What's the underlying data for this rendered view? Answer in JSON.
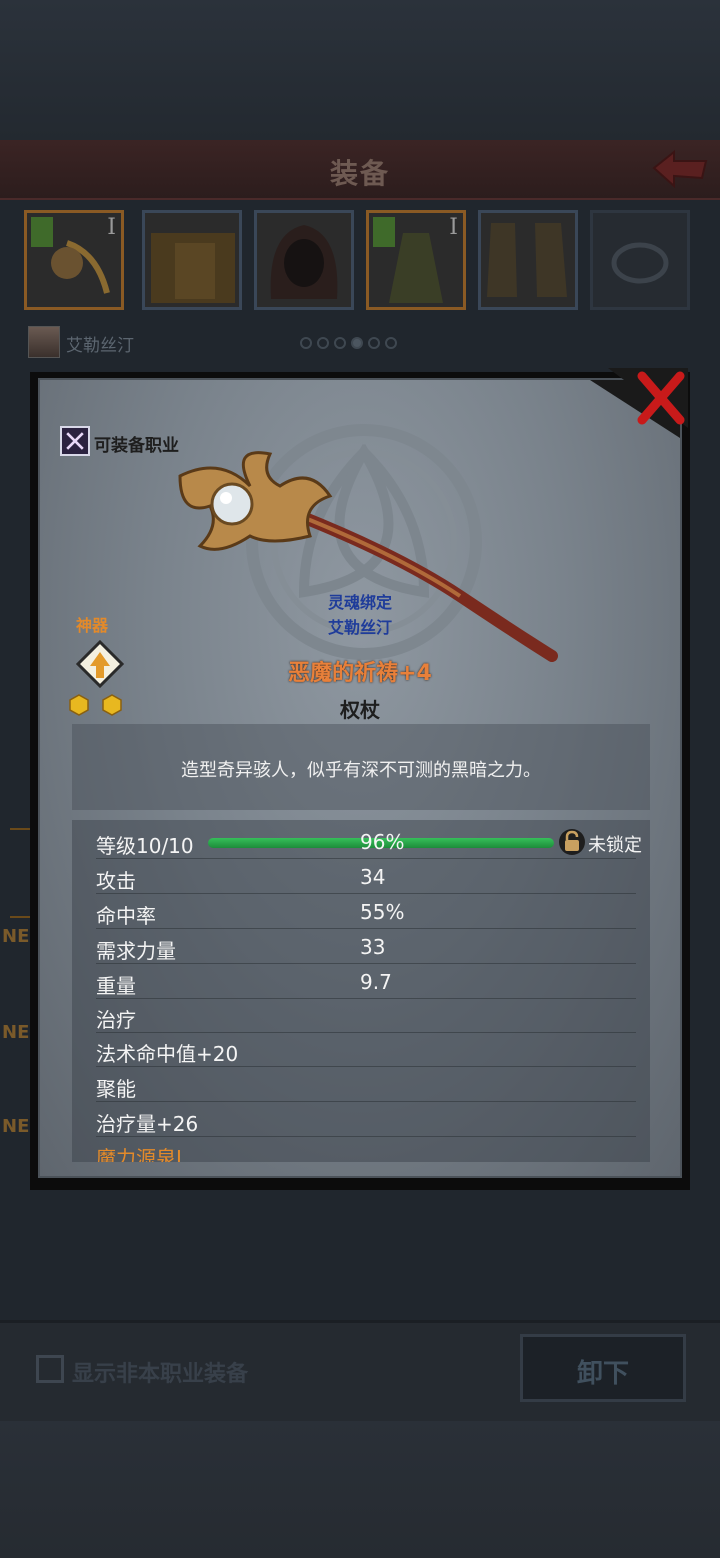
{
  "header": {
    "title": "装备"
  },
  "slots": [
    {
      "icon": "staff-icon",
      "level": "I",
      "selected": true
    },
    {
      "icon": "armor-icon",
      "level": "",
      "selected": false
    },
    {
      "icon": "hood-icon",
      "level": "",
      "selected": false
    },
    {
      "icon": "robe-icon",
      "level": "I",
      "selected": true
    },
    {
      "icon": "boots-icon",
      "level": "",
      "selected": false
    },
    {
      "icon": "ring-icon",
      "level": "",
      "selected": false
    }
  ],
  "character": {
    "name": "艾勒丝汀"
  },
  "side_tags": [
    "NE",
    "NE",
    "NE"
  ],
  "item": {
    "class_label": "可装备职业",
    "artifact_label": "神器",
    "artifact_stars": 2,
    "soul_bind": "灵魂绑定",
    "bound_to": "艾勒丝汀",
    "name": "恶魔的祈祷+4",
    "type": "权杖",
    "description": "造型奇异骇人，似乎有深不可测的黑暗之力。"
  },
  "stats": {
    "level_label": "等级10/10",
    "level_percent_text": "96%",
    "level_progress": 0.96,
    "lock_label": "未锁定",
    "rows": [
      {
        "name": "攻击",
        "value": "34"
      },
      {
        "name": "命中率",
        "value": "55%"
      },
      {
        "name": "需求力量",
        "value": "33"
      },
      {
        "name": "重量",
        "value": "9.7"
      },
      {
        "name": "治疗",
        "value": ""
      },
      {
        "name": "法术命中值+20",
        "value": ""
      },
      {
        "name": "聚能",
        "value": ""
      },
      {
        "name": "治疗量+26",
        "value": ""
      },
      {
        "name": "魔力源泉I",
        "value": ""
      }
    ]
  },
  "bottom": {
    "checkbox_label": "显示非本职业装备",
    "unequip_label": "卸下"
  },
  "colors": {
    "item_name": "#e8803a",
    "artifact": "#e38a2a",
    "soul_bind": "#1f3c9a",
    "progress": "#2eb052"
  }
}
